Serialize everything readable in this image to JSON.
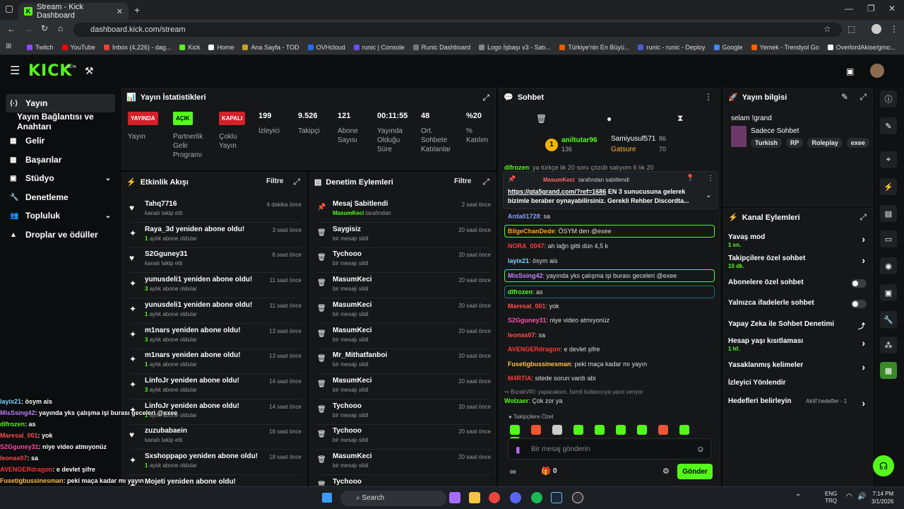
{
  "browser": {
    "tab_title": "Stream - Kick Dashboard",
    "url": "dashboard.kick.com/stream",
    "bookmarks": [
      "Twitch",
      "YouTube",
      "Inbox (4,226) - dag...",
      "Kick",
      "Home",
      "Ana Sayfa - TOD",
      "OVHcloud",
      "runic | Console",
      "Runic Dashboard",
      "Logo İşbaşı v3 - Satı...",
      "Türkiye'nin En Büyü...",
      "runic - runic - Deploy",
      "Google",
      "Yemek - Trendyol Go",
      "OverlordAkise/gmo..."
    ]
  },
  "kick": {
    "logo": "KICK",
    "beta": "BETA"
  },
  "nav": [
    {
      "label": "Yayın",
      "icon": "stream-icon"
    },
    {
      "label": "Yayın Bağlantısı ve Anahtarı"
    },
    {
      "label": "Gelir",
      "icon": "revenue-icon"
    },
    {
      "label": "Başarılar",
      "icon": "achievements-icon"
    },
    {
      "label": "Stüdyo",
      "icon": "studio-icon"
    },
    {
      "label": "Denetleme",
      "icon": "moderation-icon"
    },
    {
      "label": "Topluluk",
      "icon": "community-icon"
    },
    {
      "label": "Droplar ve ödüller",
      "icon": "drops-icon"
    }
  ],
  "stats": {
    "title": "Yayın İstatistikleri",
    "stream": {
      "badge": "YAYINDA",
      "label": "Yayın"
    },
    "partner": {
      "badge": "AÇIK",
      "label": "Partnerlik Gelir Programı"
    },
    "multi": {
      "badge": "KAPALI",
      "label": "Çoklu Yayın"
    },
    "viewers": {
      "value": "199",
      "label": "İzleyici"
    },
    "followers": {
      "value": "9.526",
      "label": "Takipçi"
    },
    "subs": {
      "value": "121",
      "label": "Abone Sayısı"
    },
    "uptime": {
      "value": "00:11:55",
      "label": "Yayında Olduğu Süre"
    },
    "avg_chat": {
      "value": "48",
      "label": "Ort. Sohbete Katılanlar"
    },
    "participation": {
      "value": "%20",
      "label": "% Katılım"
    }
  },
  "activity": {
    "title": "Etkinlik Akışı",
    "filter": "Filtre",
    "items": [
      {
        "title": "Tahq7716",
        "sub": "kanalı takip etti",
        "time": "4 dakika önce",
        "icon": "heart-icon"
      },
      {
        "title": "Raya_3d yeniden abone oldu!",
        "num": "1",
        "sub": "aylık abone oldular",
        "time": "3 saat önce",
        "icon": "sparkle-icon"
      },
      {
        "title": "S2Gguney31",
        "sub": "kanalı takip etti",
        "time": "6 saat önce",
        "icon": "heart-icon"
      },
      {
        "title": "yunusdeli1 yeniden abone oldu!",
        "num": "3",
        "sub": "aylık abone oldular",
        "time": "11 saat önce",
        "icon": "sparkle-icon"
      },
      {
        "title": "yunusdeli1 yeniden abone oldu!",
        "num": "1",
        "sub": "aylık abone oldular",
        "time": "11 saat önce",
        "icon": "sparkle-icon"
      },
      {
        "title": "m1nars yeniden abone oldu!",
        "num": "3",
        "sub": "aylık abone oldular",
        "time": "13 saat önce",
        "icon": "sparkle-icon"
      },
      {
        "title": "m1nars yeniden abone oldu!",
        "num": "1",
        "sub": "aylık abone oldular",
        "time": "13 saat önce",
        "icon": "sparkle-icon"
      },
      {
        "title": "LinfoJr yeniden abone oldu!",
        "num": "3",
        "sub": "aylık abone oldular",
        "time": "14 saat önce",
        "icon": "sparkle-icon"
      },
      {
        "title": "LinfoJr yeniden abone oldu!",
        "num": "1",
        "sub": "aylık abone oldular",
        "time": "14 saat önce",
        "icon": "sparkle-icon"
      },
      {
        "title": "zuzubabaein",
        "sub": "kanalı takip etti",
        "time": "16 saat önce",
        "icon": "heart-icon"
      },
      {
        "title": "Sxshoppapo yeniden abone oldu!",
        "num": "1",
        "sub": "aylık abone oldular",
        "time": "18 saat önce",
        "icon": "sparkle-icon"
      },
      {
        "title": "Mojeti yeniden abone oldu!",
        "sub": "",
        "time": "",
        "icon": "sparkle-icon"
      }
    ]
  },
  "modlog": {
    "title": "Denetim Eylemleri",
    "filter": "Filtre",
    "items": [
      {
        "title": "Mesaj Sabitlendi",
        "user": "MasumKeci",
        "sub": "tarafından",
        "time": "2 saat önce",
        "icon": "pin-icon"
      },
      {
        "title": "Saygisiz",
        "sub": "bir mesajı sildi",
        "time": "20 saat önce",
        "icon": "trash-icon"
      },
      {
        "title": "Tychooo",
        "sub": "bir mesajı sildi",
        "time": "20 saat önce",
        "icon": "trash-icon"
      },
      {
        "title": "MasumKeci",
        "sub": "bir mesajı sildi",
        "time": "20 saat önce",
        "icon": "trash-icon"
      },
      {
        "title": "MasumKeci",
        "sub": "bir mesajı sildi",
        "time": "20 saat önce",
        "icon": "trash-icon"
      },
      {
        "title": "MasumKeci",
        "sub": "bir mesajı sildi",
        "time": "20 saat önce",
        "icon": "trash-icon"
      },
      {
        "title": "Mr_Mithatfanboi",
        "sub": "bir mesajı sildi",
        "time": "20 saat önce",
        "icon": "trash-icon"
      },
      {
        "title": "MasumKeci",
        "sub": "bir mesajı sildi",
        "time": "20 saat önce",
        "icon": "trash-icon"
      },
      {
        "title": "Tychooo",
        "sub": "bir mesajı sildi",
        "time": "20 saat önce",
        "icon": "trash-icon"
      },
      {
        "title": "Tychooo",
        "sub": "bir mesajı sildi",
        "time": "20 saat önce",
        "icon": "trash-icon"
      },
      {
        "title": "MasumKeci",
        "sub": "bir mesajı sildi",
        "time": "20 saat önce",
        "icon": "trash-icon"
      },
      {
        "title": "Tychooo",
        "sub": "",
        "time": "",
        "icon": "trash-icon"
      }
    ]
  },
  "chat": {
    "title": "Sohbet",
    "leader": {
      "rank": "1",
      "first_name": "aniltutar96",
      "first_count": "136",
      "second_name": "Samiyusuf571",
      "second_count": "86",
      "third_name": "Gatsure",
      "third_count": "70"
    },
    "top_partial": {
      "name": "dlfrozen",
      "text": ": ya türkçe lik 20 soru çözüb salıyom 6 lık 20"
    },
    "pinned": {
      "by": "MasumKeci",
      "label": "tarafından sabitlendi",
      "link": "https://gta5grand.com/?ref=1686",
      "text": "EN 3 sunucusuna gelerek bizimle beraber oynayabilirsiniz. Gerekli Rehber Discordta..."
    },
    "messages": [
      {
        "name": "Arda01728",
        "text": ": sa",
        "color": "#8aa0ff"
      },
      {
        "name": "BilgeChanDede",
        "text": ": ÖSYM den @exee",
        "color": "#ff9a3c",
        "hl": true
      },
      {
        "name": "NORA_0047",
        "text": ": ah lağn gitti dün 4,5 k",
        "color": "#ff3a3a"
      },
      {
        "name": "layix21",
        "text": ": ösym ais",
        "color": "#7fd6ff"
      },
      {
        "name": "MisSsing42",
        "text": ": yayında yks çalışma işi burası geceleri @exee",
        "color": "#c280ff",
        "hl": true
      },
      {
        "name": "dlfrozen",
        "text": ": as",
        "color": "#53fc18",
        "hl2": true
      },
      {
        "name": "Maresal_001",
        "text": ": yok",
        "color": "#ff5050"
      },
      {
        "name": "S2Gguney31",
        "text": ": niye video atmıyonüz",
        "color": "#ff4fa8"
      },
      {
        "name": "leonas07",
        "text": ": sa",
        "color": "#ff5050"
      },
      {
        "name": "AVENGERdragon",
        "text": ": e devlet şifre",
        "color": "#ff3a3a"
      },
      {
        "name": "Fusetigbussinesman",
        "text": ": peki maça kadar mı yayın",
        "color": "#ffc04d"
      },
      {
        "name": "M4RTIA",
        "text": ": sitede sorun vardı abi",
        "color": "#ff3a3a"
      }
    ],
    "reply_note": "BurakVRI: yapacaksın. İsimli kullanıcıya yanıt veriyor",
    "last": {
      "name": "Wolzaer",
      "text": ": Çok zor ya",
      "color": "#53fc18"
    },
    "followers_only": "Takipçilere Özel",
    "placeholder": "Bir mesaj gönderin",
    "count": "0",
    "send": "Gönder"
  },
  "info": {
    "title": "Yayın bilgisi",
    "stream_title": "selam !grand",
    "category": "Sadece Sohbet",
    "tags": [
      "Turkish",
      "RP",
      "Roleplay",
      "exee"
    ]
  },
  "actions": {
    "title": "Kanal Eylemleri",
    "items": [
      {
        "label": "Yavaş mod",
        "sub": "1 sn.",
        "type": "chev"
      },
      {
        "label": "Takipçilere özel sohbet",
        "sub": "10 dk.",
        "type": "chev"
      },
      {
        "label": "Abonelere özel sohbet",
        "type": "toggle"
      },
      {
        "label": "Yalnızca ifadelerle sohbet",
        "type": "toggle"
      },
      {
        "label": "Yapay Zeka ile Sohbet Denetimi",
        "type": "ext"
      },
      {
        "label": "Hesap yaşı kısıtlaması",
        "sub": "1 hf.",
        "type": "chev"
      },
      {
        "label": "Yasaklanmış kelimeler",
        "type": "chev"
      },
      {
        "label": "İzleyici Yönlendir",
        "type": "none"
      },
      {
        "label": "Hedefleri belirleyin",
        "extra": "Aktif hedefler - 1",
        "type": "chev"
      }
    ]
  },
  "overlay": [
    {
      "name": "layix21",
      "text": ": ösym ais",
      "color": "#7fd6ff"
    },
    {
      "name": "MisSsing42",
      "text": ": yayında yks çalışma işi burası geceleri @exee",
      "color": "#c280ff"
    },
    {
      "name": "dlfrozen",
      "text": ": as",
      "color": "#53fc18"
    },
    {
      "name": "Maresal_001",
      "text": ": yok",
      "color": "#ff5050"
    },
    {
      "name": "S2Gguney31",
      "text": ": niye video atmıyonüz",
      "color": "#ff4fa8"
    },
    {
      "name": "leonas07",
      "text": ": sa",
      "color": "#ff5050"
    },
    {
      "name": "AVENGERdragon",
      "text": ": e devlet şifre",
      "color": "#ff3a3a"
    },
    {
      "name": "Fusetigbussinesman",
      "text": ": peki maça kadar mı yayın",
      "color": "#ffc04d"
    },
    {
      "name": "M4RTIA",
      "text": ": sitede sorun vardı abi",
      "color": "#ff3a3a"
    },
    {
      "name": "Wolzaer",
      "text": ": Çok zor ya",
      "color": "#53fc18"
    }
  ],
  "taskbar": {
    "search": "Search",
    "lang1": "ENG",
    "lang2": "TRQ",
    "time": "7:14 PM",
    "date": "3/1/2026"
  },
  "colors": {
    "accent": "#53fc18",
    "live": "#d4202a",
    "bg": "#0b0e0f",
    "panel": "#151718"
  }
}
